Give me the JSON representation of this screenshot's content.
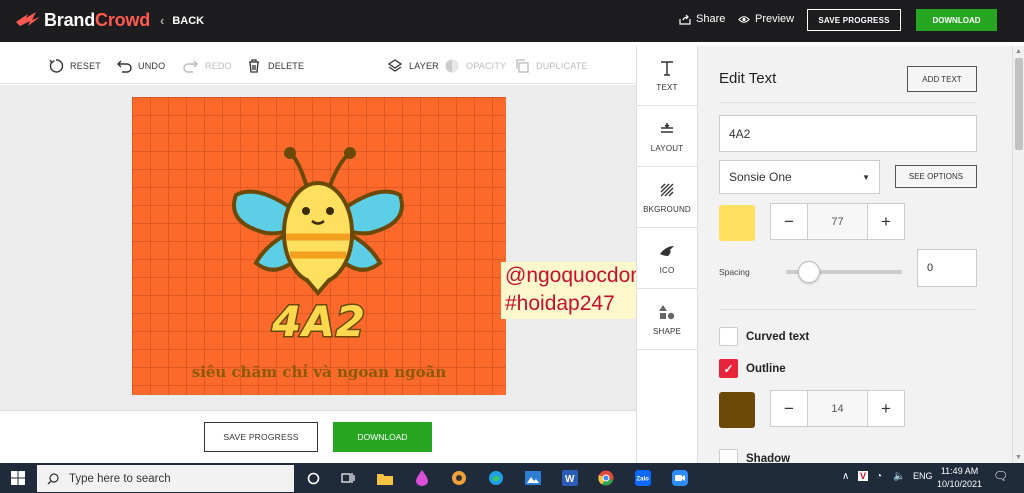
{
  "topbar": {
    "brand_part1": "Brand",
    "brand_part2": "Crowd",
    "back_label": "BACK",
    "share_label": "Share",
    "preview_label": "Preview",
    "save_progress_label": "SAVE PROGRESS",
    "download_label": "DOWNLOAD"
  },
  "toolbar": {
    "reset": "RESET",
    "undo": "UNDO",
    "redo": "REDO",
    "delete": "DELETE",
    "layer": "LAYER",
    "opacity": "OPACITY",
    "duplicate": "DUPLICATE"
  },
  "design": {
    "main_text": "4A2",
    "subtitle": "siêu chăm chỉ và ngoan ngoãn",
    "background_color": "#fb6a2b"
  },
  "watermark": {
    "line1": "@ngoquocdong",
    "line2": "#hoidap247"
  },
  "bottom_actions": {
    "save_progress_label": "SAVE PROGRESS",
    "download_label": "DOWNLOAD"
  },
  "side_tabs": [
    {
      "label": "TEXT",
      "icon": "text-icon"
    },
    {
      "label": "LAYOUT",
      "icon": "layout-icon"
    },
    {
      "label": "BKGROUND",
      "icon": "background-icon"
    },
    {
      "label": "ICO",
      "icon": "icon-bird-icon"
    },
    {
      "label": "SHAPE",
      "icon": "shape-icon"
    }
  ],
  "panel": {
    "title": "Edit Text",
    "add_text_label": "ADD TEXT",
    "text_value": "4A2",
    "font_value": "Sonsie One",
    "see_options_label": "SEE OPTIONS",
    "text_color": "#ffdf5e",
    "font_size": "77",
    "spacing_label": "Spacing",
    "spacing_value": "0",
    "spacing_fraction": 0.2,
    "curved_text_label": "Curved text",
    "curved_text_checked": false,
    "outline_label": "Outline",
    "outline_checked": true,
    "outline_color": "#6b4a07",
    "outline_size": "14",
    "shadow_label": "Shadow",
    "shadow_checked": false
  },
  "taskbar": {
    "search_placeholder": "Type here to search",
    "language": "ENG",
    "time": "11:49 AM",
    "date": "10/10/2021"
  }
}
